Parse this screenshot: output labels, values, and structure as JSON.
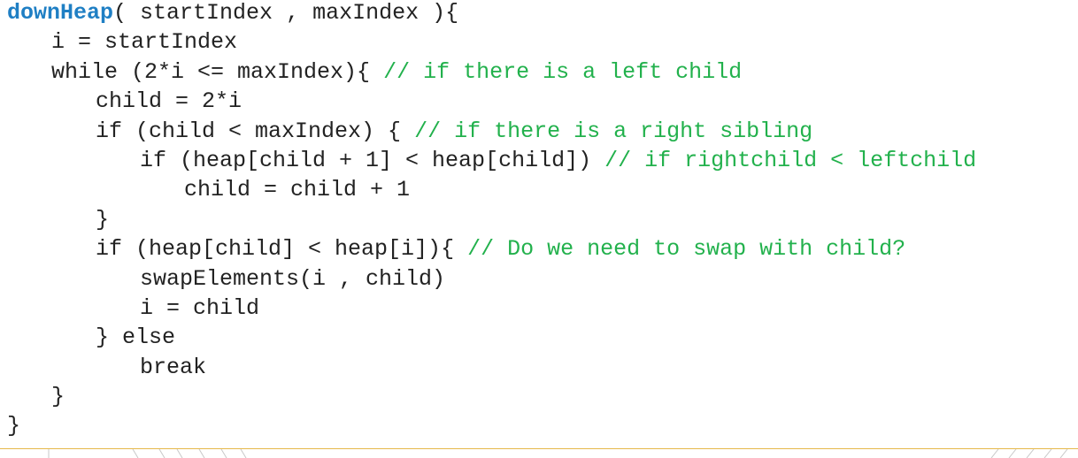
{
  "code": {
    "l1_fn": "downHeap",
    "l1_rest": "( startIndex , maxIndex ){",
    "l2": "i = startIndex",
    "l3_code": "while (2*i <= maxIndex){ ",
    "l3_comment": "// if there is a left child",
    "l4": "child = 2*i",
    "l5_code": "if (child < maxIndex) { ",
    "l5_comment": "// if there is a right sibling",
    "l6_code": "if (heap[child + 1] < heap[child]) ",
    "l6_comment": "// if rightchild < leftchild",
    "l7": "child = child + 1",
    "l8": "}",
    "l9_code": "if (heap[child] < heap[i]){ ",
    "l9_comment": "// Do we need to swap with child?",
    "l10": "swapElements(i , child)",
    "l11": "i = child",
    "l12": "} else",
    "l13": "break",
    "l14": "}",
    "l15": "}"
  },
  "colors": {
    "function_name": "#1f7fc4",
    "comment": "#22b14c",
    "text": "#222222",
    "footer_rule": "#e6b84a"
  }
}
